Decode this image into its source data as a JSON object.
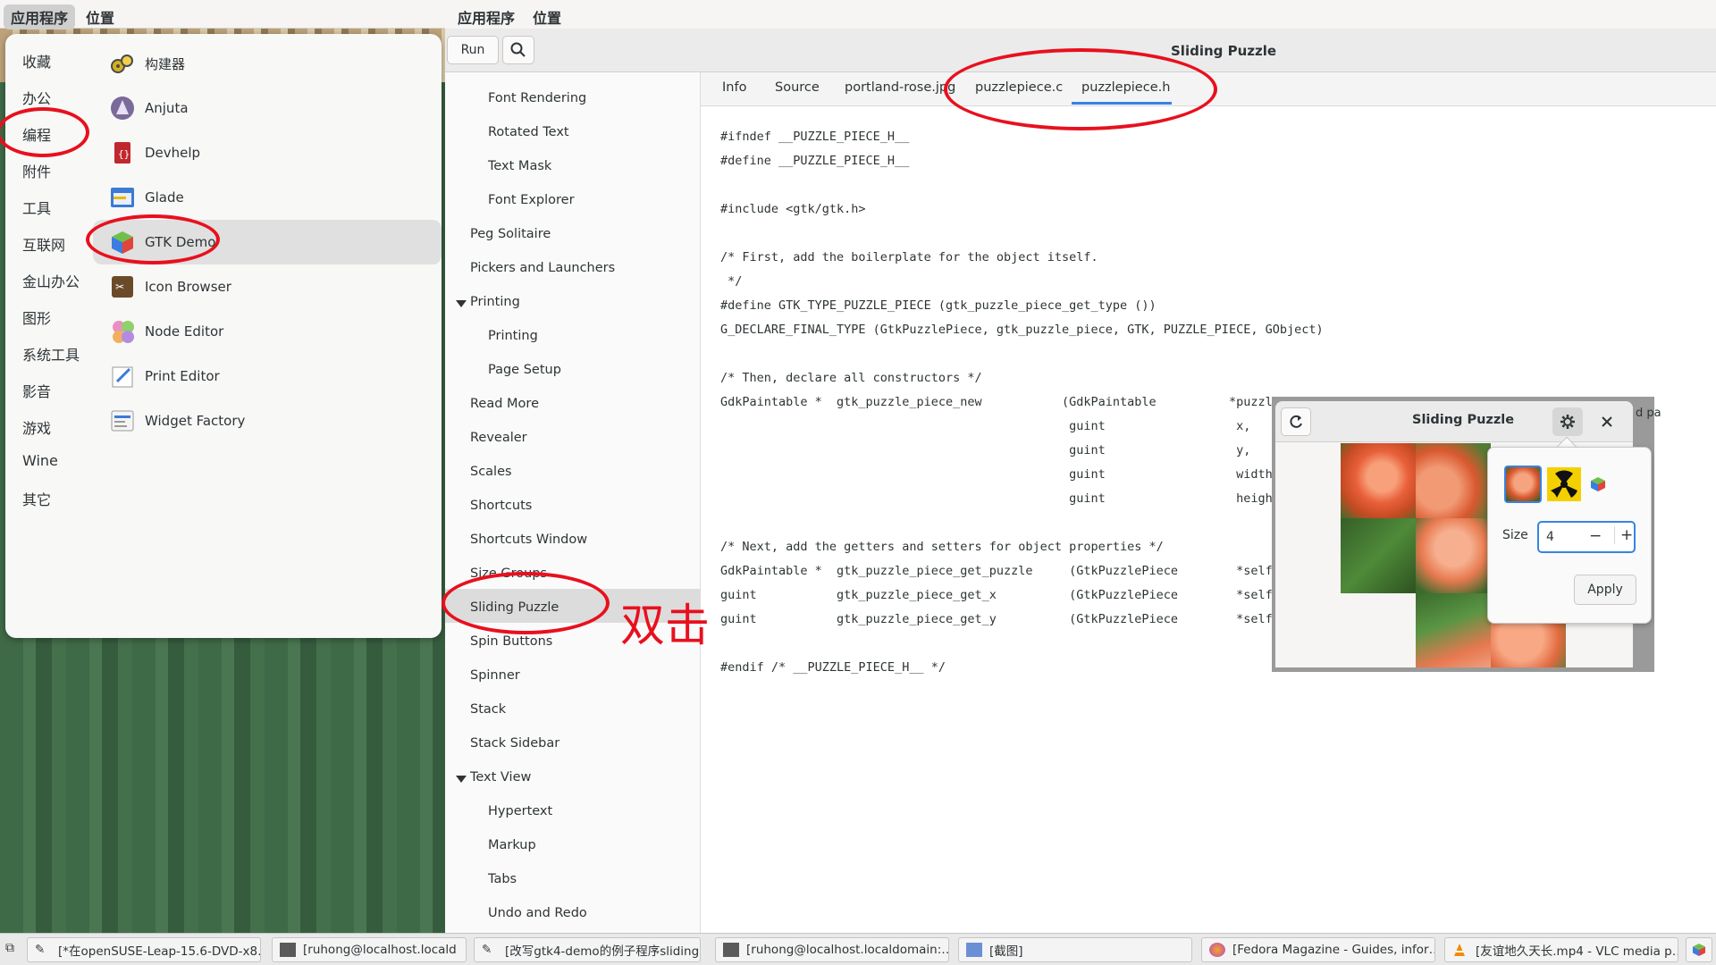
{
  "top_panel": {
    "applications": "应用程序",
    "places": "位置"
  },
  "app_menu": {
    "categories": [
      "收藏",
      "办公",
      "编程",
      "附件",
      "工具",
      "互联网",
      "金山办公",
      "图形",
      "系统工具",
      "影音",
      "游戏",
      "Wine",
      "其它"
    ],
    "apps": [
      "构建器",
      "Anjuta",
      "Devhelp",
      "Glade",
      "GTK Demo",
      "Icon Browser",
      "Node Editor",
      "Print Editor",
      "Widget Factory"
    ]
  },
  "main_window": {
    "run_label": "Run",
    "title": "Sliding Puzzle",
    "sidebar": {
      "items": [
        "Font Rendering",
        "Rotated Text",
        "Text Mask",
        "Font Explorer",
        "Peg Solitaire",
        "Pickers and Launchers",
        "Printing",
        "Printing",
        "Page Setup",
        "Read More",
        "Revealer",
        "Scales",
        "Shortcuts",
        "Shortcuts Window",
        "Size Groups",
        "Sliding Puzzle",
        "Spin Buttons",
        "Spinner",
        "Stack",
        "Stack Sidebar",
        "Text View",
        "Hypertext",
        "Markup",
        "Tabs",
        "Undo and Redo"
      ]
    },
    "tabs": [
      "Info",
      "Source",
      "portland-rose.jpg",
      "puzzlepiece.c",
      "puzzlepiece.h"
    ],
    "code_lines": [
      "#ifndef __PUZZLE_PIECE_H__",
      "#define __PUZZLE_PIECE_H__",
      "",
      "#include <gtk/gtk.h>",
      "",
      "/* First, add the boilerplate for the object itself.",
      " */",
      "#define GTK_TYPE_PUZZLE_PIECE (gtk_puzzle_piece_get_type ())",
      "G_DECLARE_FINAL_TYPE (GtkPuzzlePiece, gtk_puzzle_piece, GTK, PUZZLE_PIECE, GObject)",
      "",
      "/* Then, declare all constructors */",
      "GdkPaintable *  gtk_puzzle_piece_new           (GdkPaintable          *puzzle,",
      "                                                guint                  x,",
      "                                                guint                  y,",
      "                                                guint                  width,",
      "                                                guint                  height);",
      "",
      "/* Next, add the getters and setters for object properties */",
      "GdkPaintable *  gtk_puzzle_piece_get_puzzle     (GtkPuzzlePiece        *self);",
      "guint           gtk_puzzle_piece_get_x          (GtkPuzzlePiece        *self);",
      "guint           gtk_puzzle_piece_get_y          (GtkPuzzlePiece        *self);",
      "",
      "#endif /* __PUZZLE_PIECE_H__ */"
    ]
  },
  "puzzle_window": {
    "title": "Sliding Puzzle",
    "size_label": "Size",
    "size_value": "4",
    "minus": "−",
    "plus": "+",
    "apply_label": "Apply",
    "partial_text": "d pa"
  },
  "annotation": {
    "text": "双击",
    "color": "#e8101e"
  },
  "taskbar": {
    "items": [
      "[*在openSUSE-Leap-15.6-DVD-x8…",
      "[ruhong@localhost.locald",
      "[改写gtk4-demo的例子程序sliding…",
      "[ruhong@localhost.localdomain:…",
      "[截图]",
      "[Fedora Magazine - Guides, infor…",
      "[友谊地久天长.mp4 - VLC media p…"
    ]
  },
  "colors": {
    "accent": "#3584e4",
    "annotation_red": "#e8101e"
  }
}
